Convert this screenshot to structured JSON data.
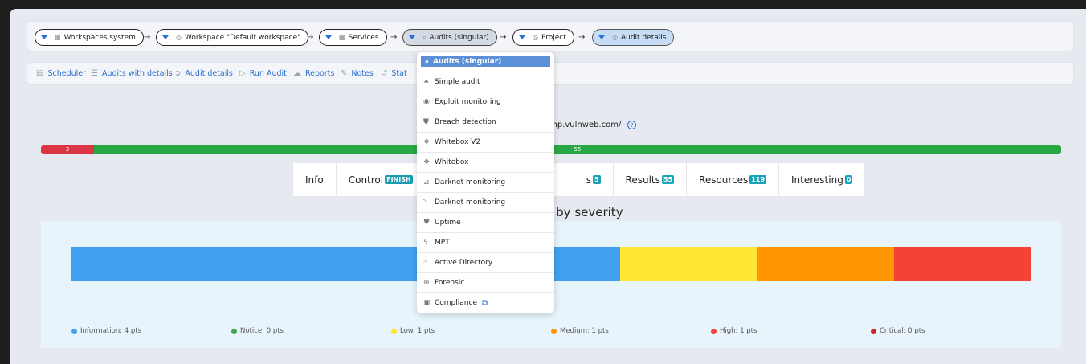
{
  "breadcrumbs": [
    {
      "label": "Workspaces system"
    },
    {
      "label": "Workspace \"Default workspace\""
    },
    {
      "label": "Services"
    },
    {
      "label": "Audits (singular)"
    },
    {
      "label": "Project"
    },
    {
      "label": "Audit details"
    }
  ],
  "actions": [
    {
      "label": "Scheduler",
      "icon": "calendar-icon"
    },
    {
      "label": "Audits with details",
      "icon": "list-icon"
    },
    {
      "label": "Audit details",
      "icon": "arrow-circle-icon"
    },
    {
      "label": "Run Audit",
      "icon": "play-icon"
    },
    {
      "label": "Reports",
      "icon": "cloud-icon"
    },
    {
      "label": "Notes",
      "icon": "edit-icon"
    },
    {
      "label": "Stat",
      "icon": "stat-icon"
    }
  ],
  "url": {
    "text": "stphp.vulnweb.com/",
    "help": "?"
  },
  "progress": {
    "red_value": "3",
    "green_value": "55",
    "red_fraction": 0.052
  },
  "tabs": [
    {
      "label": "Info",
      "badge": ""
    },
    {
      "label": "Control",
      "badge": "FINISH"
    },
    {
      "label": "s",
      "badge": "5"
    },
    {
      "label": "Results",
      "badge": "55"
    },
    {
      "label": "Resources",
      "badge": "119"
    },
    {
      "label": "Interesting",
      "badge": "0"
    }
  ],
  "severity_title": "nt by severity",
  "chart_data": {
    "type": "bar",
    "stacked": true,
    "orientation": "horizontal",
    "series": [
      {
        "name": "Information",
        "value": 4,
        "color": "#41a0f0"
      },
      {
        "name": "Notice",
        "value": 0,
        "color": "#3fa84a"
      },
      {
        "name": "Low",
        "value": 1,
        "color": "#ffe633"
      },
      {
        "name": "Medium",
        "value": 1,
        "color": "#ff9500"
      },
      {
        "name": "High",
        "value": 1,
        "color": "#f44336"
      },
      {
        "name": "Critical",
        "value": 0,
        "color": "#c62828"
      }
    ],
    "legend": [
      "Information: 4 pts",
      "Notice: 0 pts",
      "Low: 1 pts",
      "Medium: 1 pts",
      "High: 1 pts",
      "Critical: 0 pts"
    ],
    "legend_position": "bottom"
  },
  "dropdown": {
    "header": "Audits (singular)",
    "items": [
      {
        "label": "Simple audit",
        "icon": "triangle-icon"
      },
      {
        "label": "Exploit monitoring",
        "icon": "eye-icon"
      },
      {
        "label": "Breach detection",
        "icon": "shield-icon"
      },
      {
        "label": "Whitebox V2",
        "icon": "dropbox-icon"
      },
      {
        "label": "Whitebox",
        "icon": "dropbox-icon"
      },
      {
        "label": "Darknet monitoring",
        "icon": "rss-icon"
      },
      {
        "label": "Darknet monitoring",
        "icon": "wifi-icon"
      },
      {
        "label": "Uptime",
        "icon": "heartbeat-icon"
      },
      {
        "label": "MPT",
        "icon": "bolt-icon"
      },
      {
        "label": "Active Directory",
        "icon": "hand-icon"
      },
      {
        "label": "Forensic",
        "icon": "crosshair-icon"
      },
      {
        "label": "Compliance",
        "icon": "clipboard-icon"
      }
    ]
  }
}
